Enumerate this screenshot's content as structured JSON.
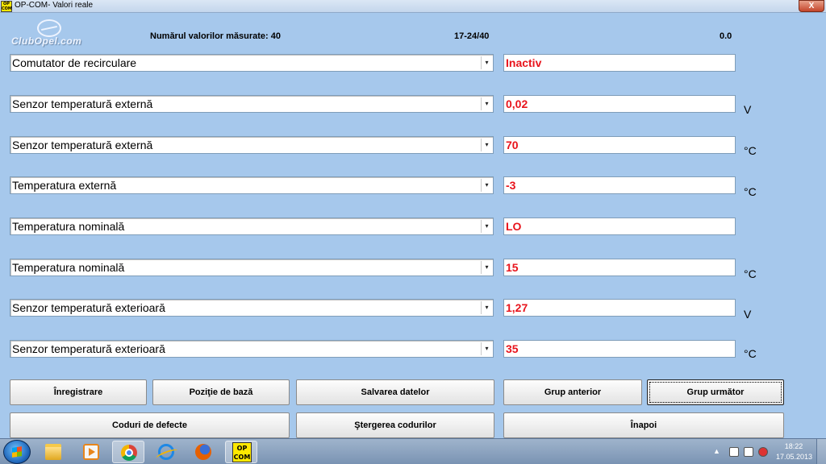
{
  "window": {
    "title": "OP-COM- Valori reale",
    "app_icon_line1": "OP",
    "app_icon_line2": "COM",
    "close_label": "X"
  },
  "header": {
    "logo_text": "ClubOpel.com",
    "measured_count_label": "Numărul valorilor măsurate: 40",
    "range": "17-24/40",
    "value": "0.0"
  },
  "rows": [
    {
      "label": "Comutator de recirculare",
      "value": "Inactiv",
      "unit": ""
    },
    {
      "label": "Senzor temperatură externă",
      "value": "0,02",
      "unit": "V"
    },
    {
      "label": "Senzor temperatură externă",
      "value": "70",
      "unit": "°C"
    },
    {
      "label": "Temperatura externă",
      "value": "-3",
      "unit": "°C"
    },
    {
      "label": "Temperatura nominală",
      "value": "LO",
      "unit": ""
    },
    {
      "label": "Temperatura nominală",
      "value": "15",
      "unit": "°C"
    },
    {
      "label": "Senzor temperatură exterioară",
      "value": "1,27",
      "unit": "V"
    },
    {
      "label": "Senzor temperatură exterioară",
      "value": "35",
      "unit": "°C"
    }
  ],
  "dropdown_arrow": "▾",
  "buttons": {
    "record": "Înregistrare",
    "base_position": "Poziţie de bază",
    "save_data": "Salvarea datelor",
    "prev_group": "Grup anterior",
    "next_group": "Grup următor",
    "fault_codes": "Coduri de defecte",
    "clear_codes": "Ştergerea codurilor",
    "back": "Înapoi"
  },
  "taskbar": {
    "apps": [
      "folder-icon",
      "media-player-icon",
      "chrome-icon",
      "ie-icon",
      "firefox-icon",
      "opcom-icon"
    ],
    "opcom_line1": "OP",
    "opcom_line2": "COM",
    "tray_arrow": "▲",
    "clock_time": "18:22",
    "clock_date": "17.05.2013"
  }
}
